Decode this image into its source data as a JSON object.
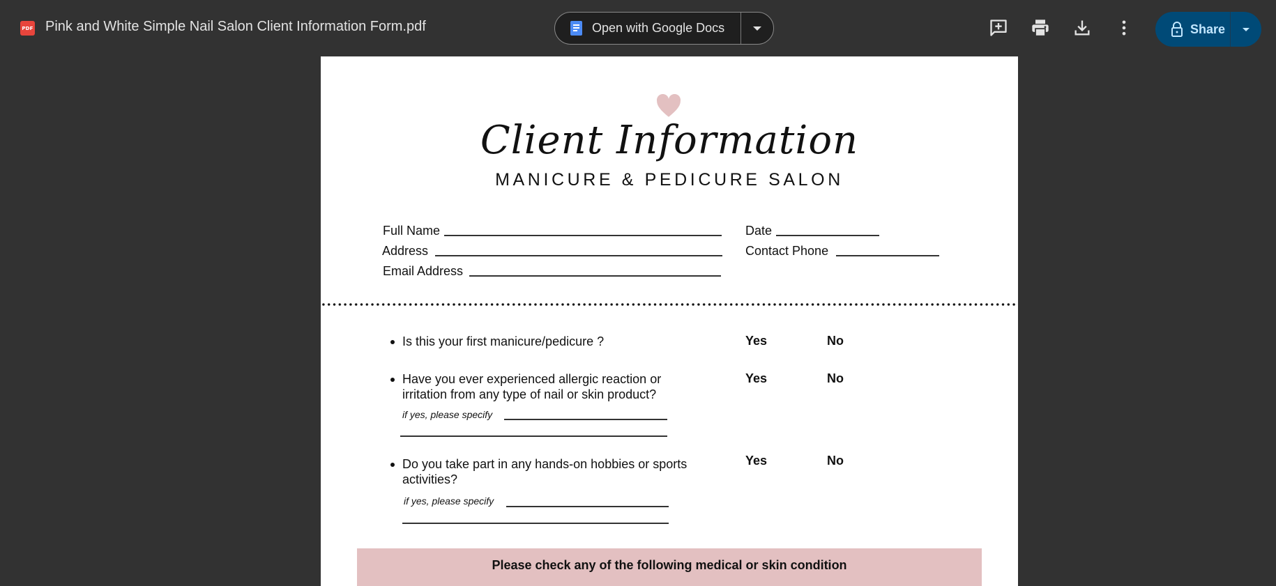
{
  "toolbar": {
    "file_badge": "PDF",
    "file_icon": "pdf-file-icon",
    "title": "Pink and White Simple Nail Salon Client Information Form.pdf",
    "open_with_label": "Open with Google Docs",
    "open_with_icon": "google-docs-icon",
    "actions": [
      {
        "name": "add-comment",
        "icon": "add-comment-icon"
      },
      {
        "name": "print",
        "icon": "print-icon"
      },
      {
        "name": "download",
        "icon": "download-icon"
      },
      {
        "name": "more-options",
        "icon": "more-vert-icon"
      }
    ],
    "share_label": "Share",
    "share_icon": "lock-icon",
    "colors": {
      "background": "#323232",
      "share_bg": "#004a77",
      "share_text": "#c2e7ff",
      "docs_blue": "#4c8bf5",
      "pdf_red": "#e8453c"
    }
  },
  "document": {
    "heart_icon": "heart-icon",
    "heart_color": "#e3c0c1",
    "script_title": "Client Information",
    "subtitle": "MANICURE & PEDICURE SALON",
    "fields_left": [
      {
        "label": "Full Name",
        "value": ""
      },
      {
        "label": "Address",
        "value": ""
      },
      {
        "label": "Email Address",
        "value": ""
      }
    ],
    "fields_right": [
      {
        "label": "Date",
        "value": ""
      },
      {
        "label": "Contact Phone",
        "value": ""
      }
    ],
    "questions": [
      {
        "text_lines": [
          "Is this your first manicure/pedicure ?"
        ],
        "yes": "Yes",
        "no": "No"
      },
      {
        "text_lines": [
          "Have you ever experienced allergic reaction or",
          "irritation from any type of nail or skin product?"
        ],
        "yes": "Yes",
        "no": "No",
        "specify": "if yes, please specify"
      },
      {
        "text_lines": [
          "Do you take part in any hands-on hobbies or sports",
          "activities?"
        ],
        "yes": "Yes",
        "no": "No",
        "specify": "if yes, please specify"
      }
    ],
    "banner_text": "Please check any of the following medical or skin condition",
    "banner_color": "#e3c0c1"
  }
}
